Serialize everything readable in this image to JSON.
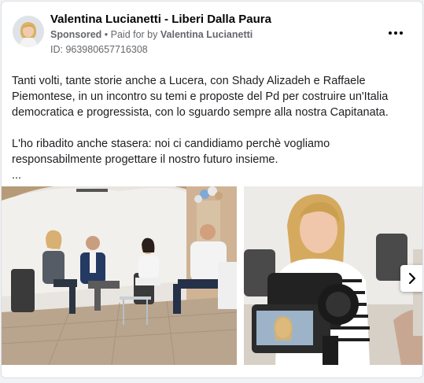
{
  "header": {
    "page_name": "Valentina Lucianetti - Liberi Dalla Paura",
    "sponsored_label": "Sponsored",
    "paid_for_prefix": "• Paid for by",
    "paid_for_name": "Valentina Lucianetti",
    "ad_id": "ID: 963980657716308"
  },
  "post": {
    "paragraph_1": "Tanti volti, tante storie anche a Lucera, con Shady Alizadeh e Raffaele Piemontese, in un incontro su temi e proposte del Pd per costruire un'Italia democratica e progressista, con lo sguardo sempre alla nostra Capitanata.",
    "paragraph_2": "L'ho ribadito anche stasera: noi ci candidiamo perchè vogliamo responsabilmente progettare il nostro futuro insieme.",
    "ellipsis": "..."
  },
  "icons": {
    "more": "more-horizontal-icon",
    "next": "chevron-right-icon"
  },
  "colors": {
    "secondary_text": "#65676b",
    "card_border": "#dddfe2"
  }
}
